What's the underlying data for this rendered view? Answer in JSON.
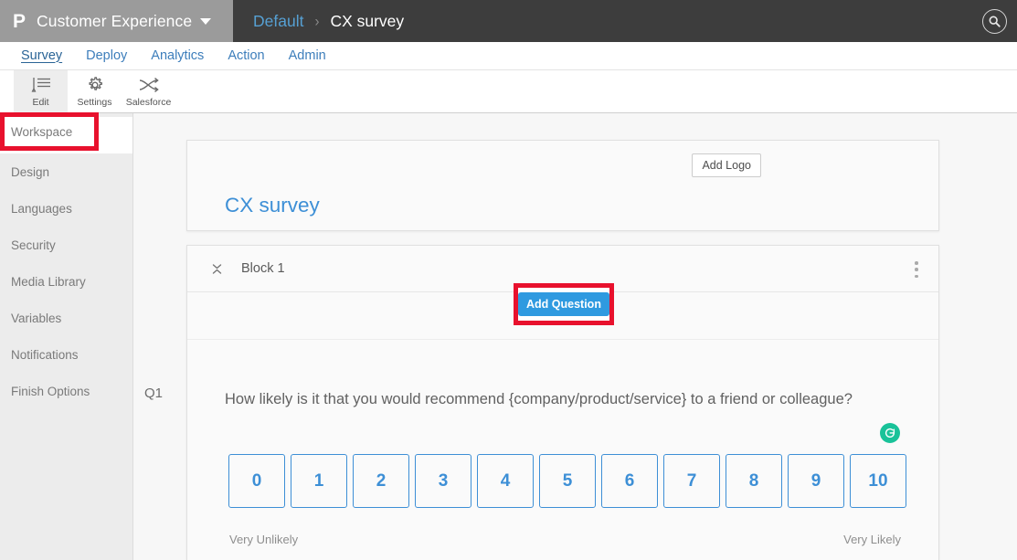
{
  "header": {
    "logo_glyph": "P",
    "brand": "Customer Experience",
    "breadcrumb_parent": "Default",
    "breadcrumb_sep": "›",
    "breadcrumb_current": "CX survey",
    "search_icon": "search-icon",
    "bg_color": "#3d3d3d",
    "brand_bg_color": "#9b9b9b",
    "link_color": "#56a0d3"
  },
  "nav": {
    "tabs": [
      {
        "label": "Survey",
        "active": true
      },
      {
        "label": "Deploy",
        "active": false
      },
      {
        "label": "Analytics",
        "active": false
      },
      {
        "label": "Action",
        "active": false
      },
      {
        "label": "Admin",
        "active": false
      }
    ]
  },
  "ribbon": {
    "items": [
      {
        "label": "Edit",
        "icon": "edit-pen-icon",
        "active": true
      },
      {
        "label": "Settings",
        "icon": "gear-icon",
        "active": false
      },
      {
        "label": "Salesforce",
        "icon": "salesforce-arrows-icon",
        "active": false
      }
    ]
  },
  "sidebar": {
    "items": [
      {
        "label": "Workspace",
        "selected": true
      },
      {
        "label": "Design",
        "selected": false
      },
      {
        "label": "Languages",
        "selected": false
      },
      {
        "label": "Security",
        "selected": false
      },
      {
        "label": "Media Library",
        "selected": false
      },
      {
        "label": "Variables",
        "selected": false
      },
      {
        "label": "Notifications",
        "selected": false
      },
      {
        "label": "Finish Options",
        "selected": false
      }
    ]
  },
  "survey": {
    "add_logo_label": "Add Logo",
    "title": "CX survey",
    "title_color": "#3d8fd6"
  },
  "block": {
    "name": "Block 1",
    "collapse_icon": "collapse-chevrons-icon",
    "menu_icon": "kebab-menu-icon",
    "add_question_label": "Add Question",
    "add_question_color": "#2f9ae0"
  },
  "question": {
    "number": "Q1",
    "text": "How likely is it that you would recommend {company/product/service} to a friend or colleague?",
    "recode_icon": "recode-refresh-icon",
    "recode_color": "#19c299",
    "scale": [
      "0",
      "1",
      "2",
      "3",
      "4",
      "5",
      "6",
      "7",
      "8",
      "9",
      "10"
    ],
    "anchor_left": "Very Unlikely",
    "anchor_right": "Very Likely",
    "scale_color": "#3d8fd6"
  },
  "annotations": {
    "color": "#e8112d",
    "targets": [
      "workspace-sidebar-item",
      "add-question-button"
    ]
  }
}
